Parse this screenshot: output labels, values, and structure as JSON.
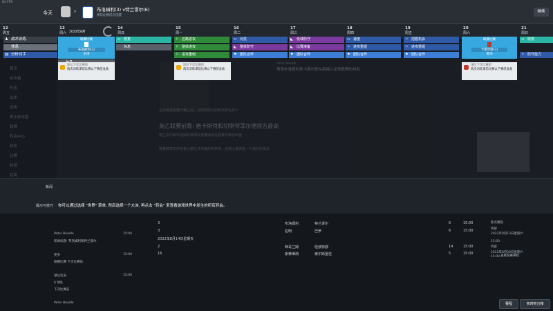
{
  "topbar": {
    "small_label": "84 FPS",
    "today_label": "今天",
    "vs_label": "v",
    "match_title": "布洛姆利(3) v特兰谬尔(6)",
    "match_sub": "赛前比赛成员提醒",
    "continue_label": "继续"
  },
  "calendar": {
    "days": [
      {
        "num": "12",
        "wd": "周五"
      },
      {
        "num": "13",
        "wd": "周六"
      },
      {
        "num": "14",
        "wd": "周日"
      },
      {
        "num": "15",
        "wd": "周一"
      },
      {
        "num": "16",
        "wd": "周二"
      },
      {
        "num": "17",
        "wd": "周三"
      },
      {
        "num": "18",
        "wd": "周四"
      },
      {
        "num": "19",
        "wd": "周五"
      },
      {
        "num": "20",
        "wd": "周六"
      },
      {
        "num": "21",
        "wd": "周日"
      }
    ],
    "date_header": "2022年8月"
  },
  "left_menu": {
    "items": [
      "战术训练",
      "休息",
      "分析对手"
    ]
  },
  "cards": {
    "match13_title": "联赛比赛",
    "match13_team": "布洛姆利(3)",
    "match13_venue": "主场",
    "match20_title": "联赛比赛",
    "match20_team": "卡莱尔联(3)",
    "match20_venue": "客场",
    "rest13": "休息",
    "col14": [
      "恢复",
      "休息"
    ],
    "col15": [
      "边路进攻",
      "整体进攻",
      "进攻重组"
    ],
    "col16": [
      "对抗",
      "整体防守",
      "团队合作"
    ],
    "col17": [
      "低球防守",
      "比赛准备",
      "团队合作"
    ],
    "col18": [
      "速度",
      "进攻重组",
      "团队合作"
    ],
    "col19": [
      "把握机会",
      "进攻重组",
      "团队合作"
    ],
    "col21": [
      "恢复",
      "防守能力"
    ],
    "notes": [
      {
        "title": "球队下次比赛前",
        "body": "两次训练课前比赛以下赛前准备"
      },
      {
        "title": "球队下次比赛前",
        "body": "两次训练课前比赛以下赛前准备"
      },
      {
        "title": "球队下次比赛前",
        "body": "两次训练课前比赛以下赛前准备"
      },
      {
        "title": "球队下次比赛前",
        "body": "两次训练课前比赛以下赛前准备"
      }
    ]
  },
  "background": {
    "nav_items": [
      "首页",
      "收件箱",
      "阵容",
      "战术",
      "训练",
      "俱乐部设置",
      "联赛",
      "转会中心",
      "财务",
      "比赛",
      "新闻",
      "招聘"
    ],
    "article_head": "Peter Beadle",
    "article_sub": "预测布洛姆利和卡莱尔联在英格兰足球联赛的排名",
    "headline": "英乙联赛前瞻: 唐卡斯特和切斯特菲尔德排名最高",
    "body1": "在本赛季联赛开赛之前，对所有球队的预测排名如下",
    "body2": "特兰谬尔和布洛姆利等球队被期待会在联赛中表现出色",
    "body3": "随着赛季的开始各队都在寻求最好的开局，这场比赛将是一个很好的测试"
  },
  "band": {
    "label1": "新闻",
    "label2": "提示与技巧",
    "tip_text": "你可以通过选择 \"世界\" 菜单, 然后选择一个大洲, 再点击 \"转会\" 来查看游戏世界中发生的所有转会。"
  },
  "lower": {
    "left_rows": [
      "Peter Beadle",
      "新闻标题: 布洛姆利和特兰谬尔",
      "更多",
      "联赛比赛 下次比赛前",
      "球队近况",
      "6 球队",
      "下次比赛前",
      "Peter Beadle"
    ],
    "left_times": [
      "15:00",
      "15:00",
      "15:00"
    ],
    "table": [
      {
        "n": "3",
        "a": "布洛姆利",
        "b": "特兰谬尔",
        "s": "6",
        "t": "15:00"
      },
      {
        "n": "3",
        "a": "伯明",
        "b": "巴罗",
        "s": "6",
        "t": "15:00"
      },
      {
        "n": "",
        "a": "2022年8月14日星期天",
        "b": "",
        "s": "",
        "t": ""
      },
      {
        "n": "2",
        "a": "西哥兰姆",
        "b": "纽波特郡",
        "s": "14",
        "t": "15:00"
      },
      {
        "n": "16",
        "a": "斯蒂维纳",
        "b": "索尔斯堡伍",
        "s": "5",
        "t": "15:00"
      }
    ],
    "right": [
      "焦点赛程",
      "阵容",
      "2022年8月13日星期六",
      "15:00",
      "阵容",
      "2022年8月20日星期六",
      "15:00",
      "查看联赛赛程"
    ]
  },
  "footer": {
    "btn1": "赛程",
    "btn2": "实时积分榜"
  }
}
